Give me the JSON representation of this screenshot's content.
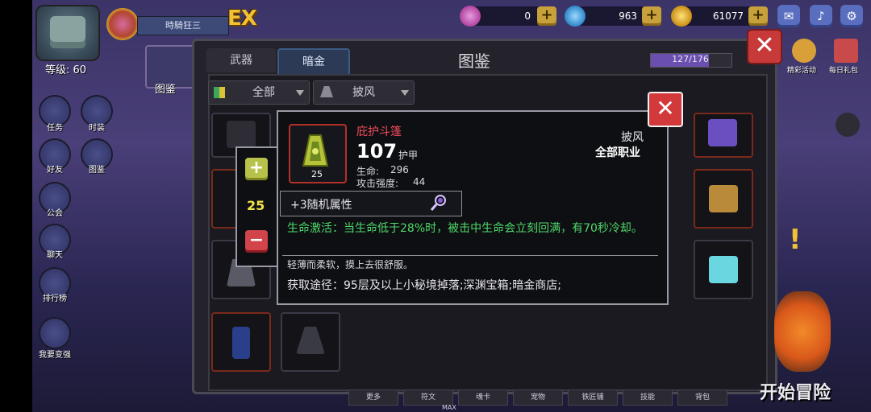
{
  "player": {
    "name": "時騎狂三",
    "level_label": "等级: 60",
    "ex_badge": "EX"
  },
  "currencies": [
    {
      "name": "gem",
      "value": "0",
      "color": "#c45ac0"
    },
    {
      "name": "diamond",
      "value": "963",
      "color": "#3a9ad9"
    },
    {
      "name": "gold",
      "value": "61077",
      "color": "#d9a52a"
    }
  ],
  "system_buttons": {
    "mail_icon": "mail-icon",
    "sound_icon": "speaker-icon",
    "settings_icon": "gear-icon"
  },
  "left_menu": [
    {
      "label": "任务",
      "icon": "quest-icon"
    },
    {
      "label": "时装",
      "icon": "costume-icon"
    },
    {
      "label": "好友",
      "icon": "friends-icon"
    },
    {
      "label": "图鉴",
      "icon": "codex-icon"
    },
    {
      "label": "公会",
      "icon": "guild-icon"
    },
    {
      "label": "聊天",
      "icon": "chat-icon"
    },
    {
      "label": "排行榜",
      "icon": "trophy-icon"
    },
    {
      "label": "我要变强",
      "icon": "powerup-icon"
    }
  ],
  "codex_shortcut_label": "图鉴",
  "right_menu": {
    "events_label": "精彩活动",
    "daily_gift_label": "每日礼包"
  },
  "panel": {
    "title": "图鉴",
    "tabs": [
      {
        "label": "武器"
      },
      {
        "label": "暗金"
      }
    ],
    "progress": {
      "text": "127/176",
      "fraction": 0.72
    },
    "filters": {
      "category": "全部",
      "slot": "披风"
    }
  },
  "bottom_tabs": [
    "更多",
    "符文",
    "魂卡",
    "宠物",
    "铁匠铺",
    "技能",
    "背包"
  ],
  "bottom_max_label": "MAX",
  "start_button": "开始冒险",
  "detail": {
    "item_name": "庇护斗篷",
    "item_level": "25",
    "main_value": "107",
    "main_value_label": "护甲",
    "stats": [
      {
        "label": "生命:",
        "value": "296"
      },
      {
        "label": "攻击强度:",
        "value": "44"
      }
    ],
    "slot_type": "披风",
    "class_type": "全部职业",
    "random_attr": "+3随机属性",
    "effect_text": "生命激活：当生命低于28%时，被击中生命会立刻回满，有70秒冷却。",
    "flavor_text": "轻薄而柔软，摸上去很舒服。",
    "source_text": "获取途径：95层及以上小秘境掉落;深渊宝箱;暗金商店;"
  },
  "stepper": {
    "value": "25",
    "plus": "+",
    "minus": "−"
  },
  "close_symbol": "✕"
}
